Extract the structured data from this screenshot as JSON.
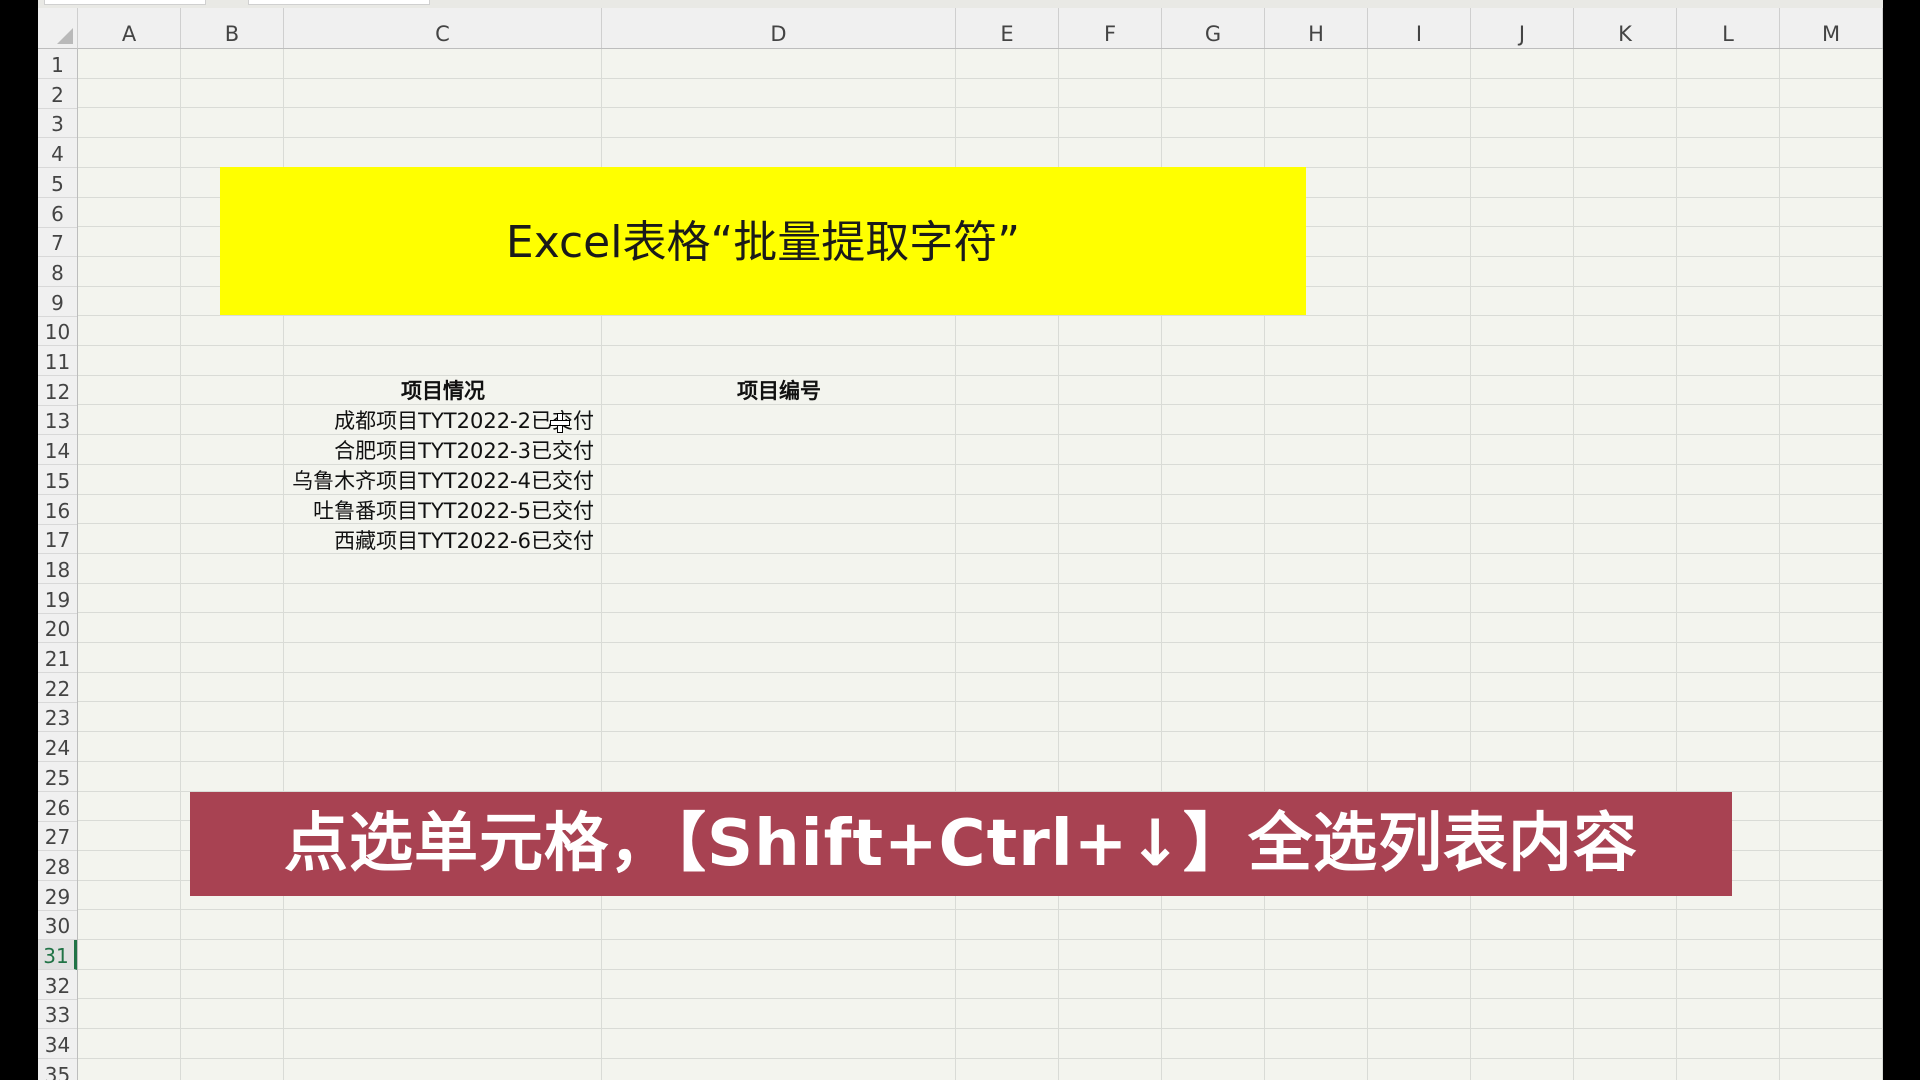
{
  "columns": [
    "A",
    "B",
    "C",
    "D",
    "E",
    "F",
    "G",
    "H",
    "I",
    "J",
    "K",
    "L",
    "M"
  ],
  "rows": [
    "1",
    "2",
    "3",
    "4",
    "5",
    "6",
    "7",
    "8",
    "9",
    "10",
    "11",
    "12",
    "13",
    "14",
    "15",
    "16",
    "17",
    "18",
    "19",
    "20",
    "21",
    "22",
    "23",
    "24",
    "25",
    "26",
    "27",
    "28",
    "29",
    "30",
    "31",
    "32",
    "33",
    "34",
    "35"
  ],
  "selected_row": "31",
  "title": "Excel表格“批量提取字符”",
  "table": {
    "header_c": "项目情况",
    "header_d": "项目编号",
    "items": [
      "成都项目TYT2022-2已交付",
      "合肥项目TYT2022-3已交付",
      "乌鲁木齐项目TYT2022-4已交付",
      "吐鲁番项目TYT2022-5已交付",
      "西藏项目TYT2022-6已交付"
    ]
  },
  "caption": "点选单元格，【Shift+Ctrl+↓】全选列表内容",
  "colors": {
    "title_bg": "#ffff00",
    "caption_bg": "#a84252",
    "accent": "#217346"
  }
}
